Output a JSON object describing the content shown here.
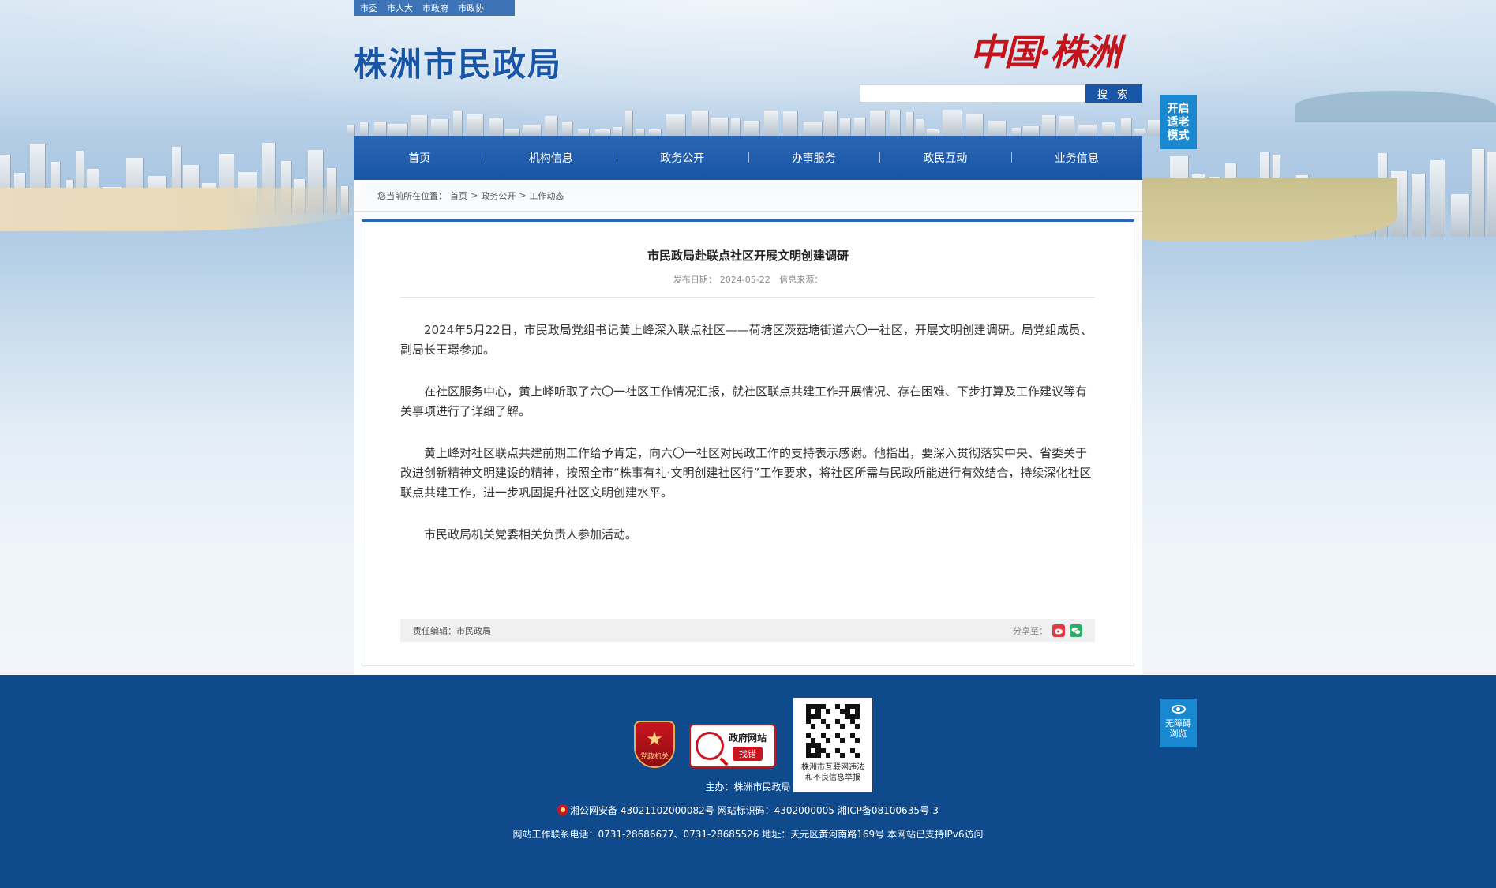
{
  "top_links": [
    "市委",
    "市人大",
    "市政府",
    "市政协"
  ],
  "site_logo": "株洲市民政局",
  "calligraphy": "中国·株洲",
  "search": {
    "placeholder": "",
    "button": "搜 索"
  },
  "elder_mode": [
    "开启",
    "适老",
    "模式"
  ],
  "nav": [
    "首页",
    "机构信息",
    "政务公开",
    "办事服务",
    "政民互动",
    "业务信息"
  ],
  "breadcrumb": {
    "prefix": "您当前所在位置：",
    "items": [
      "首页",
      "政务公开",
      "工作动态"
    ],
    "separator": ">"
  },
  "article": {
    "title": "市民政局赴联点社区开展文明创建调研",
    "date_label": "发布日期：",
    "date": "2024-05-22",
    "source_label": "信息来源：",
    "paragraphs": [
      "2024年5月22日，市民政局党组书记黄上峰深入联点社区——荷塘区茨菇塘街道六〇一社区，开展文明创建调研。局党组成员、副局长王璟参加。",
      "在社区服务中心，黄上峰听取了六〇一社区工作情况汇报，就社区联点共建工作开展情况、存在困难、下步打算及工作建议等有关事项进行了详细了解。",
      "黄上峰对社区联点共建前期工作给予肯定，向六〇一社区对民政工作的支持表示感谢。他指出，要深入贯彻落实中央、省委关于改进创新精神文明建设的精神，按照全市“株事有礼·文明创建社区行”工作要求，将社区所需与民政所能进行有效结合，持续深化社区联点共建工作，进一步巩固提升社区文明创建水平。",
      "市民政局机关党委相关负责人参加活动。"
    ],
    "editor": "责任编辑：市民政局",
    "share_label": "分享至："
  },
  "footer": {
    "party_badge": "党政机关",
    "error_badge": {
      "line1": "政府网站",
      "line2": "找错"
    },
    "qr_caption": [
      "株洲市互联网违法",
      "和不良信息举报"
    ],
    "accessible": [
      "无障碍",
      "浏览"
    ],
    "host": "主办：株洲市民政局",
    "record": "湘公网安备 43021102000082号 网站标识码：4302000005 湘ICP备08100635号-3",
    "contact": "网站工作联系电话：0731-28686677、0731-28685526 地址：天元区黄河南路169号 本网站已支持IPv6访问"
  },
  "colors": {
    "brand_blue": "#1a56a8",
    "footer_blue": "#0e4a8c",
    "accent_red": "#c4141b"
  }
}
